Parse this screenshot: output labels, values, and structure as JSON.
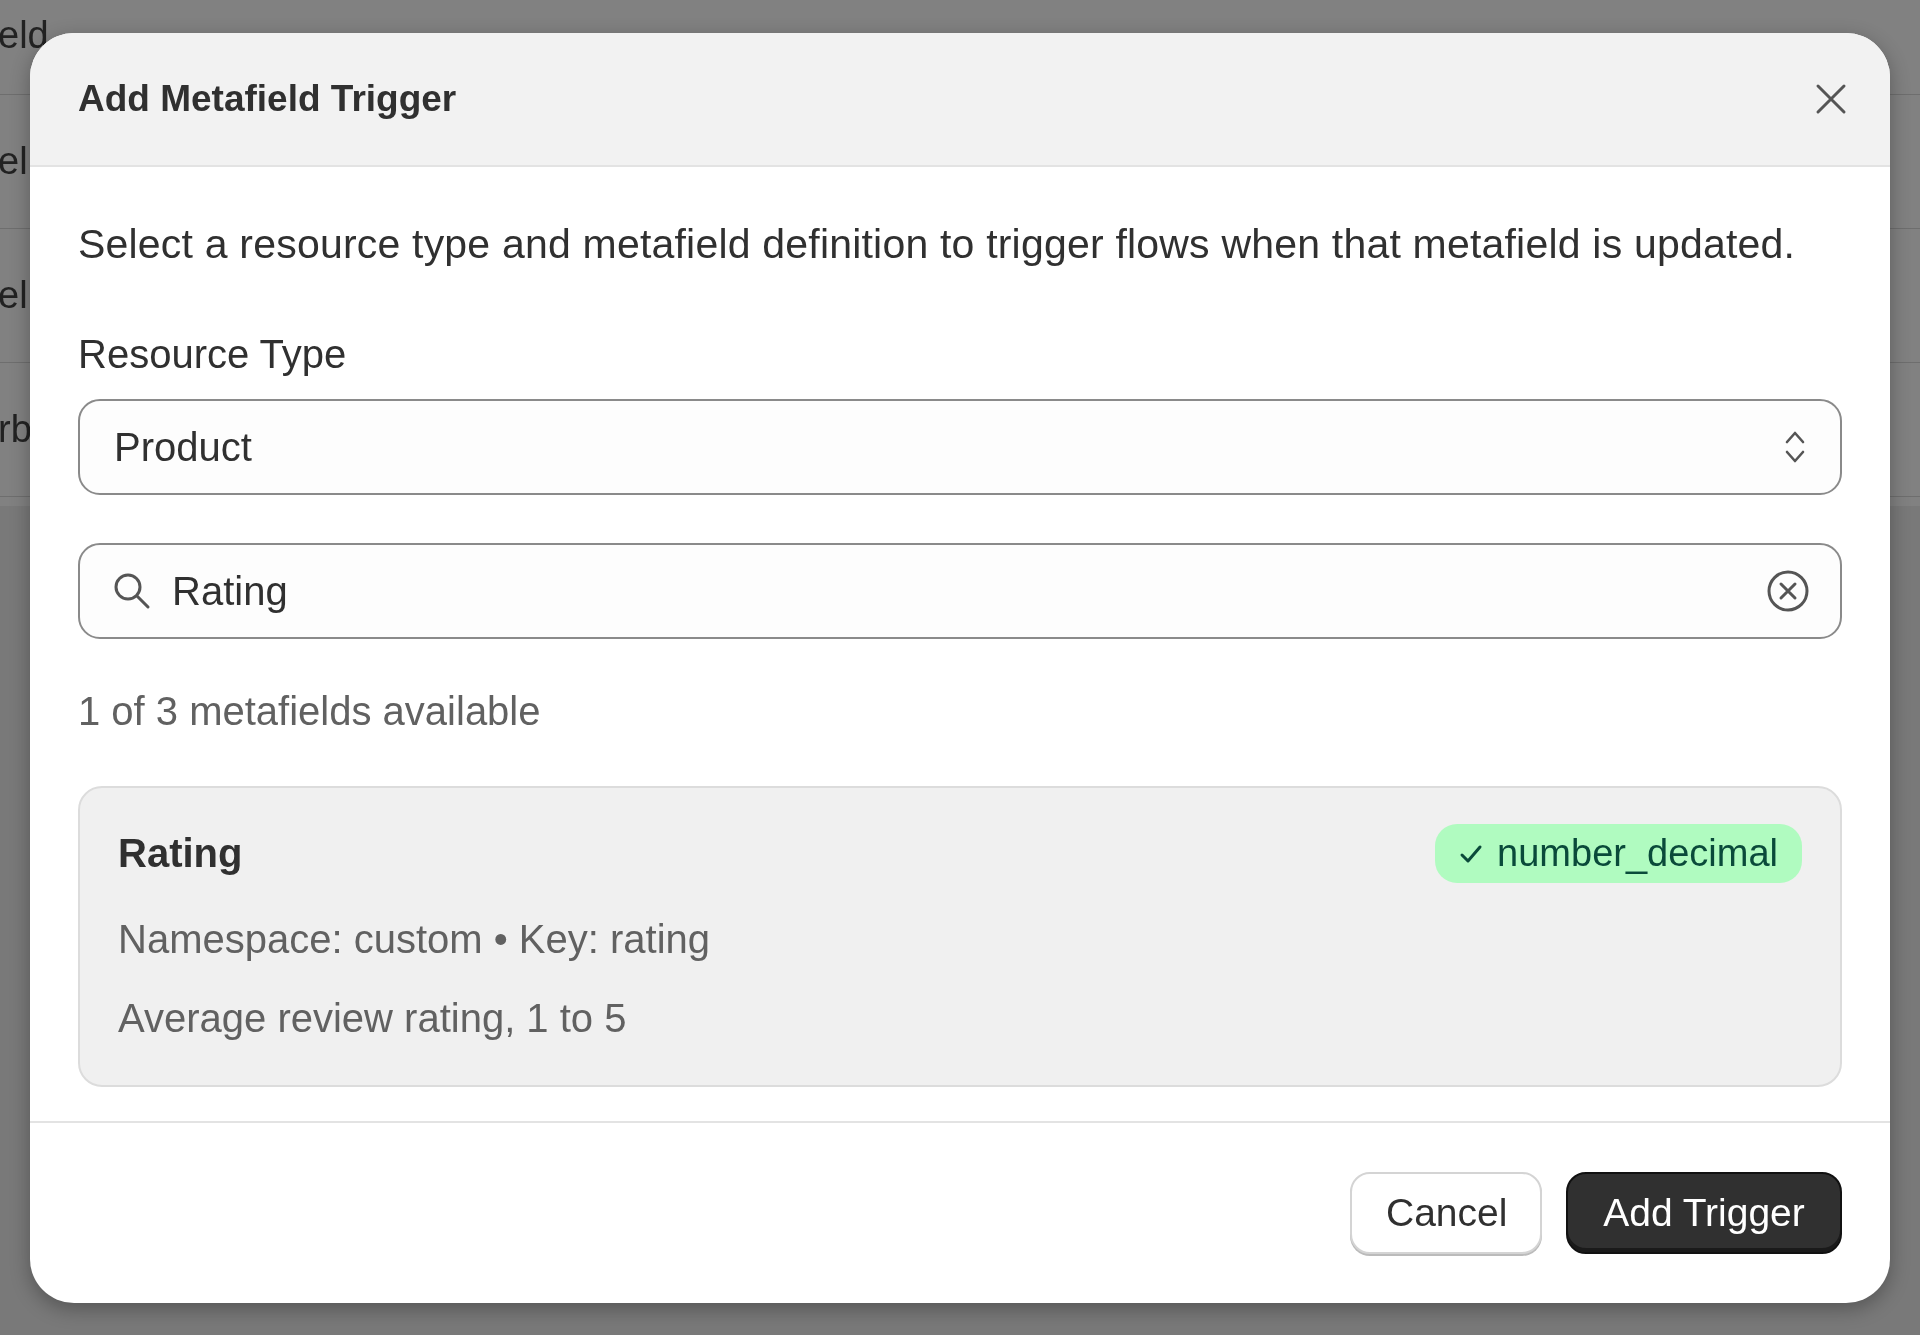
{
  "background": {
    "row_fragments": [
      "eld",
      "el",
      "el",
      "rb"
    ]
  },
  "dialog": {
    "title": "Add Metafield Trigger",
    "description": "Select a resource type and metafield definition to trigger flows when that metafield is updated.",
    "resource_type": {
      "label": "Resource Type",
      "value": "Product"
    },
    "search": {
      "value": "Rating"
    },
    "count": "1 of 3 metafields available",
    "results": [
      {
        "name": "Rating",
        "type_badge": "number_decimal",
        "matched": true,
        "meta": "Namespace: custom • Key: rating",
        "description": "Average review rating, 1 to 5",
        "selected": true
      }
    ],
    "buttons": [
      {
        "label": "Cancel",
        "kind": "secondary"
      },
      {
        "label": "Add Trigger",
        "kind": "primary"
      }
    ]
  }
}
